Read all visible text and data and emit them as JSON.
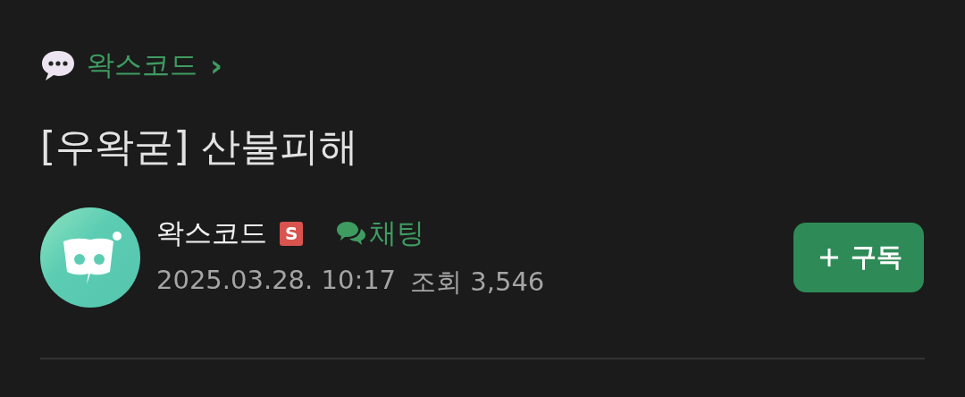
{
  "breadcrumb": {
    "label": "왁스코드",
    "chevron": "›"
  },
  "title": "[우왁굳] 산불피해",
  "author": {
    "name": "왁스코드",
    "badge": "S",
    "chat_label": "채팅",
    "date": "2025.03.28. 10:17",
    "views_label": "조회",
    "views": "3,546"
  },
  "subscribe_button": {
    "label": "구독"
  }
}
